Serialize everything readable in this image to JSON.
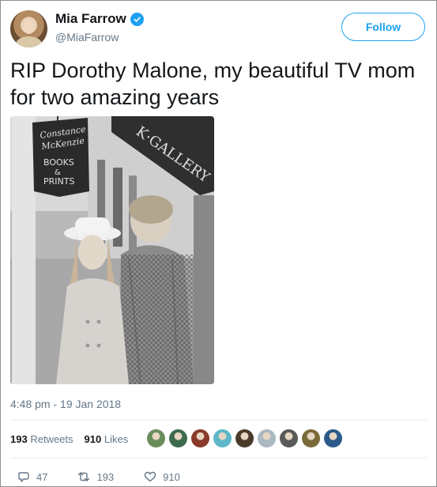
{
  "user": {
    "name": "Mia Farrow",
    "handle": "@MiaFarrow",
    "verified_icon": "verified-badge-icon",
    "follow_label": "Follow"
  },
  "tweet": {
    "text": "RIP Dorothy Malone,  my beautiful TV mom for two amazing years",
    "photo": {
      "sign_script_line1": "Constance",
      "sign_script_line2": "McKenzie",
      "sign_books": "BOOKS",
      "sign_and": "&",
      "sign_prints": "PRINTS",
      "gallery_sign": "K·GALLERY"
    },
    "timestamp": "4:48 pm - 19 Jan 2018"
  },
  "stats": {
    "retweets_count": "193",
    "retweets_label": "Retweets",
    "likes_count": "910",
    "likes_label": "Likes"
  },
  "likers": [
    {
      "icon": "liker-avatar-1",
      "color": "#6a8c5a"
    },
    {
      "icon": "liker-avatar-2",
      "color": "#3e6b4f"
    },
    {
      "icon": "liker-avatar-3",
      "color": "#8a3a2a"
    },
    {
      "icon": "liker-avatar-4",
      "color": "#5fb8c8"
    },
    {
      "icon": "liker-avatar-5",
      "color": "#4a3a2a"
    },
    {
      "icon": "liker-avatar-6",
      "color": "#aab8c2"
    },
    {
      "icon": "liker-avatar-7",
      "color": "#5a5a5a"
    },
    {
      "icon": "liker-avatar-8",
      "color": "#7a6a3a"
    },
    {
      "icon": "liker-avatar-9",
      "color": "#2a5a8a"
    }
  ],
  "actions": {
    "reply_count": "47",
    "retweet_count": "193",
    "like_count": "910"
  },
  "colors": {
    "accent": "#1da1f2",
    "muted": "#657786",
    "text": "#14171a"
  }
}
